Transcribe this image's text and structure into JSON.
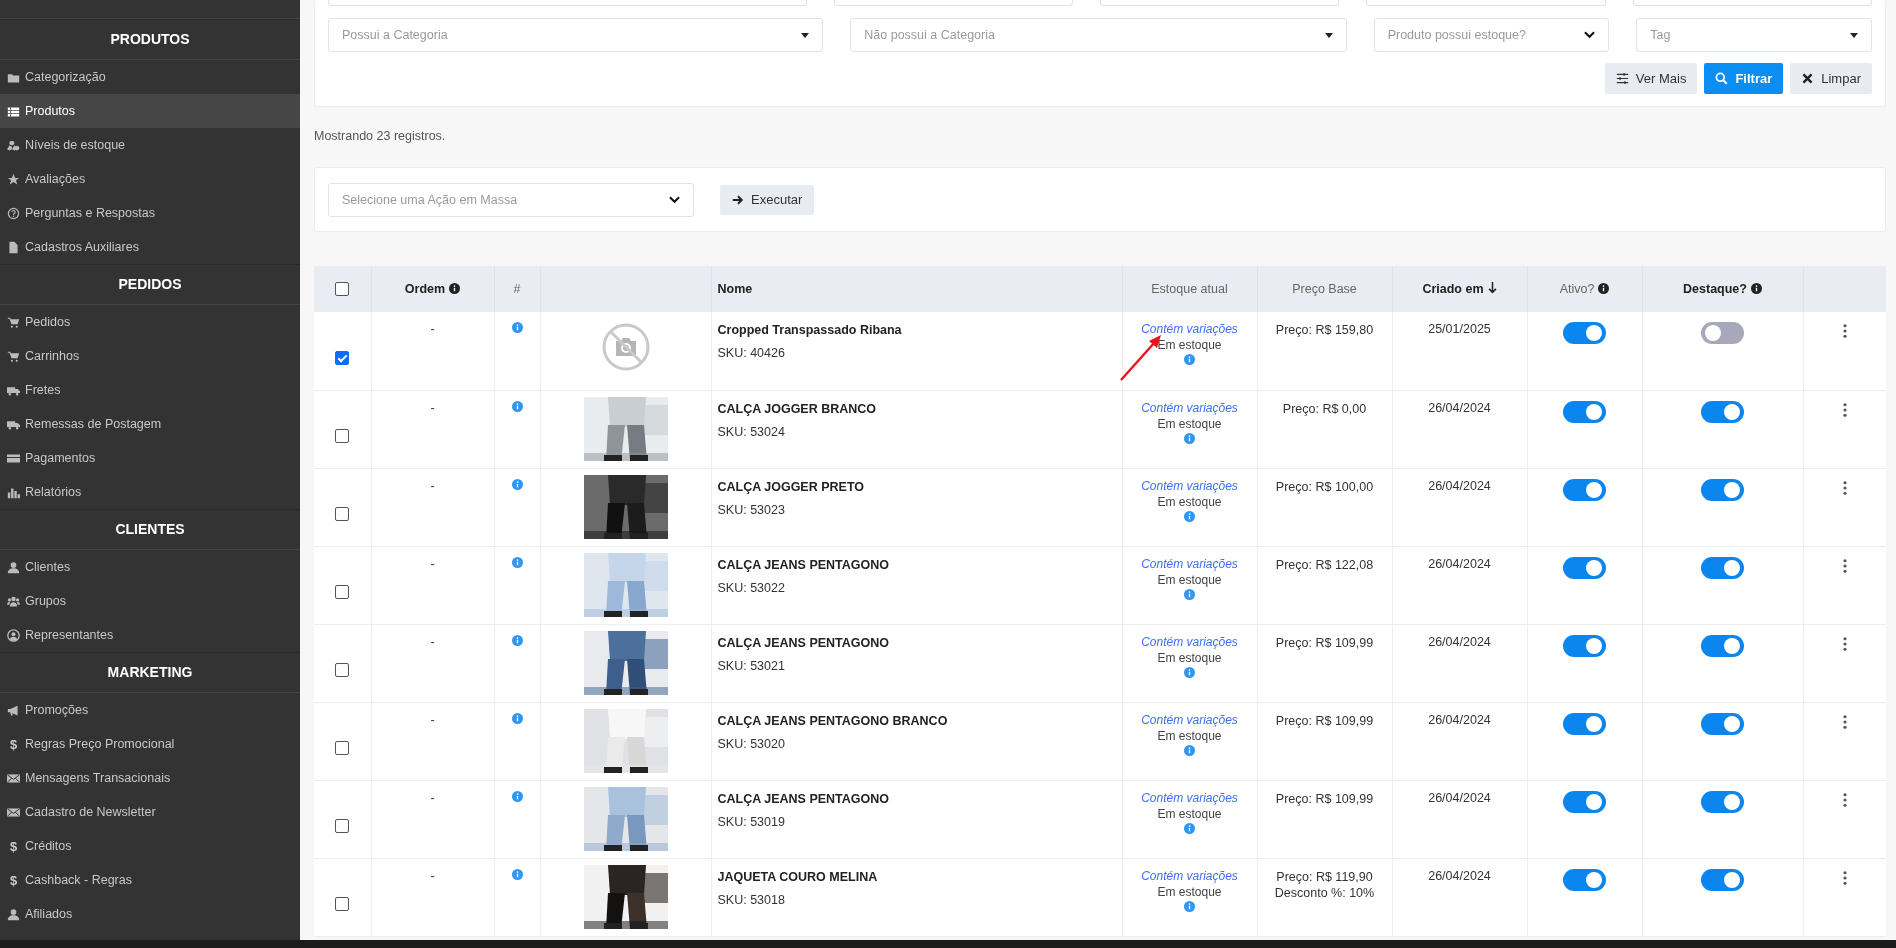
{
  "sidebar": {
    "sections": [
      {
        "title": "PRODUTOS",
        "items": [
          {
            "label": "Categorização",
            "selected": false
          },
          {
            "label": "Produtos",
            "selected": true
          },
          {
            "label": "Níveis de estoque",
            "selected": false
          },
          {
            "label": "Avaliações",
            "selected": false
          },
          {
            "label": "Perguntas e Respostas",
            "selected": false
          },
          {
            "label": "Cadastros Auxiliares",
            "selected": false
          }
        ]
      },
      {
        "title": "PEDIDOS",
        "items": [
          {
            "label": "Pedidos",
            "selected": false
          },
          {
            "label": "Carrinhos",
            "selected": false
          },
          {
            "label": "Fretes",
            "selected": false
          },
          {
            "label": "Remessas de Postagem",
            "selected": false
          },
          {
            "label": "Pagamentos",
            "selected": false
          },
          {
            "label": "Relatórios",
            "selected": false
          }
        ]
      },
      {
        "title": "CLIENTES",
        "items": [
          {
            "label": "Clientes",
            "selected": false
          },
          {
            "label": "Grupos",
            "selected": false
          },
          {
            "label": "Representantes",
            "selected": false
          }
        ]
      },
      {
        "title": "MARKETING",
        "items": [
          {
            "label": "Promoções",
            "selected": false
          },
          {
            "glyph": "$",
            "label": "Regras Preço Promocional",
            "selected": false
          },
          {
            "label": "Mensagens Transacionais",
            "selected": false
          },
          {
            "label": "Cadastro de Newsletter",
            "selected": false
          },
          {
            "glyph": "$",
            "label": "Créditos",
            "selected": false
          },
          {
            "glyph": "$",
            "label": "Cashback - Regras",
            "selected": false
          },
          {
            "label": "Afiliados",
            "selected": false
          }
        ]
      }
    ]
  },
  "filters": {
    "fields": [
      {
        "placeholder": "Possui a Categoria",
        "kind": "select"
      },
      {
        "placeholder": "Não possui a Categoria",
        "kind": "select"
      },
      {
        "placeholder": "Produto possui estoque?",
        "kind": "native"
      },
      {
        "placeholder": "Tag",
        "kind": "select"
      }
    ],
    "buttons": [
      {
        "label": "Ver Mais",
        "kind": "sliders"
      },
      {
        "label": "Filtrar",
        "kind": "search"
      },
      {
        "label": "Limpar",
        "kind": "clear"
      }
    ]
  },
  "record_count": "Mostrando 23 registros.",
  "bulk_action": {
    "placeholder": "Selecione uma Ação em Massa",
    "button": "Executar"
  },
  "table": {
    "select_all": {
      "checked": false
    },
    "columns": [
      {
        "label": "Ordem",
        "sortable": true,
        "info": true
      },
      {
        "label": "#",
        "sortable": false,
        "info": false
      },
      {
        "label": "Nome",
        "sortable": true,
        "info": false
      },
      {
        "label": "Estoque atual",
        "sortable": false,
        "info": false
      },
      {
        "label": "Preço Base",
        "sortable": false,
        "info": false
      },
      {
        "label": "Criado em",
        "sortable": true,
        "info": false,
        "sorted_descending": true
      },
      {
        "label": "Ativo?",
        "sortable": false,
        "info": true
      },
      {
        "label": "Destaque?",
        "sortable": true,
        "info": true
      }
    ],
    "rows": [
      {
        "checked": true,
        "order": "-",
        "has_photo": false,
        "name": "Cropped Transpassado Ribana",
        "sku": "SKU: 40426",
        "stock_link": "Contém variações",
        "stock": "Em estoque",
        "marked": true,
        "price": [
          "Preço: R$ 159,80"
        ],
        "created": "25/01/2025",
        "active": true,
        "featured": false
      },
      {
        "checked": false,
        "order": "-",
        "has_photo": true,
        "name": "CALÇA JOGGER BRANCO",
        "sku": "SKU: 53024",
        "stock_link": "Contém variações",
        "stock": "Em estoque",
        "marked": false,
        "price": [
          "Preço: R$ 0,00"
        ],
        "created": "26/04/2024",
        "active": true,
        "featured": true
      },
      {
        "checked": false,
        "order": "-",
        "has_photo": true,
        "name": "CALÇA JOGGER PRETO",
        "sku": "SKU: 53023",
        "stock_link": "Contém variações",
        "stock": "Em estoque",
        "marked": false,
        "price": [
          "Preço: R$ 100,00"
        ],
        "created": "26/04/2024",
        "active": true,
        "featured": true
      },
      {
        "checked": false,
        "order": "-",
        "has_photo": true,
        "name": "CALÇA JEANS PENTAGONO",
        "sku": "SKU: 53022",
        "stock_link": "Contém variações",
        "stock": "Em estoque",
        "marked": false,
        "price": [
          "Preço: R$ 122,08"
        ],
        "created": "26/04/2024",
        "active": true,
        "featured": true
      },
      {
        "checked": false,
        "order": "-",
        "has_photo": true,
        "name": "CALÇA JEANS PENTAGONO",
        "sku": "SKU: 53021",
        "stock_link": "Contém variações",
        "stock": "Em estoque",
        "marked": false,
        "price": [
          "Preço: R$ 109,99"
        ],
        "created": "26/04/2024",
        "active": true,
        "featured": true
      },
      {
        "checked": false,
        "order": "-",
        "has_photo": true,
        "name": "CALÇA JEANS PENTAGONO BRANCO",
        "sku": "SKU: 53020",
        "stock_link": "Contém variações",
        "stock": "Em estoque",
        "marked": false,
        "price": [
          "Preço: R$ 109,99"
        ],
        "created": "26/04/2024",
        "active": true,
        "featured": true
      },
      {
        "checked": false,
        "order": "-",
        "has_photo": true,
        "name": "CALÇA JEANS PENTAGONO",
        "sku": "SKU: 53019",
        "stock_link": "Contém variações",
        "stock": "Em estoque",
        "marked": false,
        "price": [
          "Preço: R$ 109,99"
        ],
        "created": "26/04/2024",
        "active": true,
        "featured": true
      },
      {
        "checked": false,
        "order": "-",
        "has_photo": true,
        "name": "JAQUETA COURO MELINA",
        "sku": "SKU: 53018",
        "stock_link": "Contém variações",
        "stock": "Em estoque",
        "marked": false,
        "price": [
          "Preço: R$ 119,90",
          "Desconto %: 10%"
        ],
        "created": "26/04/2024",
        "active": true,
        "featured": true
      }
    ]
  }
}
